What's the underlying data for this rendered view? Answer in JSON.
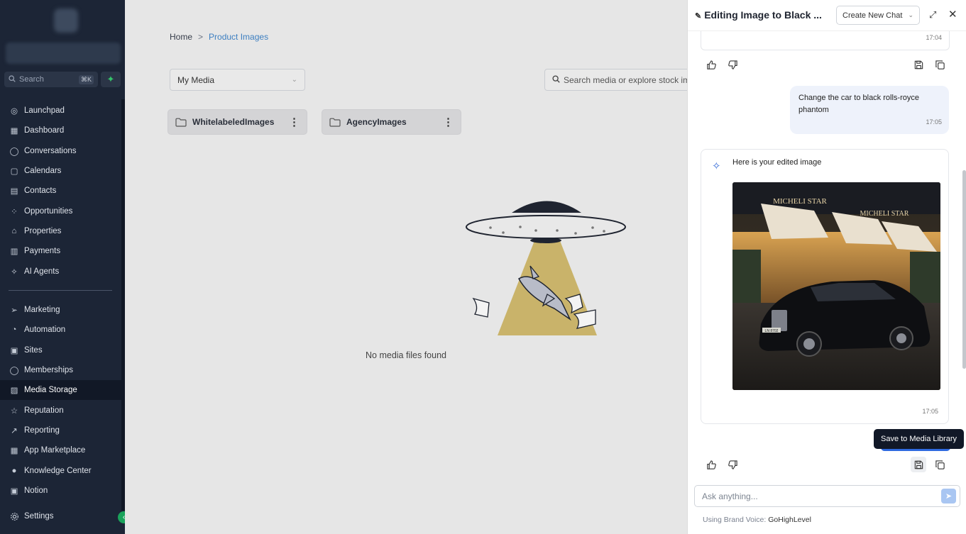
{
  "sidebar": {
    "search_placeholder": "Search",
    "search_shortcut": "⌘K",
    "nav_top": [
      {
        "label": "Launchpad",
        "icon": "rocket-icon"
      },
      {
        "label": "Dashboard",
        "icon": "grid-icon"
      },
      {
        "label": "Conversations",
        "icon": "chat-bubble-icon"
      },
      {
        "label": "Calendars",
        "icon": "calendar-icon"
      },
      {
        "label": "Contacts",
        "icon": "contacts-icon"
      },
      {
        "label": "Opportunities",
        "icon": "network-icon"
      },
      {
        "label": "Properties",
        "icon": "home-icon"
      },
      {
        "label": "Payments",
        "icon": "receipt-icon"
      },
      {
        "label": "AI Agents",
        "icon": "sparkle-icon"
      }
    ],
    "nav_bottom": [
      {
        "label": "Marketing",
        "icon": "send-icon"
      },
      {
        "label": "Automation",
        "icon": "automation-icon"
      },
      {
        "label": "Sites",
        "icon": "sites-icon"
      },
      {
        "label": "Memberships",
        "icon": "badge-icon"
      },
      {
        "label": "Media Storage",
        "icon": "image-icon",
        "active": true
      },
      {
        "label": "Reputation",
        "icon": "star-icon"
      },
      {
        "label": "Reporting",
        "icon": "trend-icon"
      },
      {
        "label": "App Marketplace",
        "icon": "apps-icon"
      },
      {
        "label": "Knowledge Center",
        "icon": "info-icon"
      },
      {
        "label": "Notion",
        "icon": "notion-icon"
      }
    ],
    "settings_label": "Settings"
  },
  "main": {
    "breadcrumb": {
      "home": "Home",
      "separator": ">",
      "current": "Product Images"
    },
    "media_select": "My Media",
    "search_placeholder": "Search media or explore stock im",
    "folders": [
      {
        "name": "WhitelabeledImages"
      },
      {
        "name": "AgencyImages"
      }
    ],
    "empty_text": "No media files found"
  },
  "panel": {
    "title": "Editing Image to Black ...",
    "new_chat_label": "Create New Chat",
    "prev_time": "17:04",
    "user_message": "Change the car to black rolls-royce phantom",
    "user_time": "17:05",
    "ai_message": "Here is your edited image",
    "ai_time": "17:05",
    "image_sign_1": "MICHELI STAR",
    "image_sign_2": "MICHELI STAR",
    "image_plate": "LN 8702",
    "tooltip": "Save to Media Library",
    "composer_placeholder": "Ask anything...",
    "voice_label": "Using Brand Voice:",
    "voice_value": "GoHighLevel"
  },
  "colors": {
    "sidebar_bg": "#1c2536",
    "accent_blue": "#3d7fc1",
    "active_green": "#1aa35b"
  }
}
